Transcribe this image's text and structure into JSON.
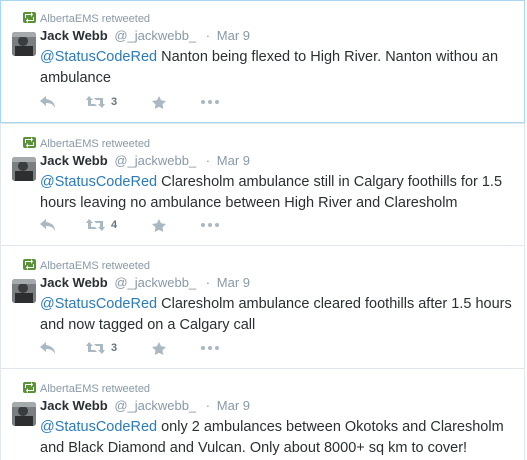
{
  "tweets": [
    {
      "retweeted_by": "AlbertaEMS retweeted",
      "name": "Jack Webb",
      "handle": "@_jackwebb_",
      "separator": "·",
      "date": "Mar 9",
      "mention": "@StatusCodeRed",
      "text": " Nanton being flexed  to High River. Nanton withou an ambulance",
      "retweet_count": "3",
      "icons": {
        "reply": "reply-icon",
        "retweet": "retweet-icon",
        "favorite": "star-icon",
        "more": "more-icon"
      }
    },
    {
      "retweeted_by": "AlbertaEMS retweeted",
      "name": "Jack Webb",
      "handle": "@_jackwebb_",
      "separator": "·",
      "date": "Mar 9",
      "mention": "@StatusCodeRed",
      "text": " Claresholm ambulance still in Calgary foothills for 1.5 hours leaving no ambulance between High River and Claresholm",
      "retweet_count": "4"
    },
    {
      "retweeted_by": "AlbertaEMS retweeted",
      "name": "Jack Webb",
      "handle": "@_jackwebb_",
      "separator": "·",
      "date": "Mar 9",
      "mention": "@StatusCodeRed",
      "text": " Claresholm ambulance cleared foothills after 1.5 hours and now tagged on a Calgary call",
      "retweet_count": "3"
    },
    {
      "retweeted_by": "AlbertaEMS retweeted",
      "name": "Jack Webb",
      "handle": "@_jackwebb_",
      "separator": "·",
      "date": "Mar 9",
      "mention": "@StatusCodeRed",
      "text": " only 2 ambulances between Okotoks and Claresholm and Black Diamond and Vulcan. Only about 8000+ sq km to cover!",
      "retweet_count": ""
    }
  ],
  "colors": {
    "mention": "#2b7bb9",
    "meta": "#8899a6",
    "retweet_badge": "#5c913b",
    "border": "#e1e8ed",
    "selected_border": "#a9d6f0"
  }
}
